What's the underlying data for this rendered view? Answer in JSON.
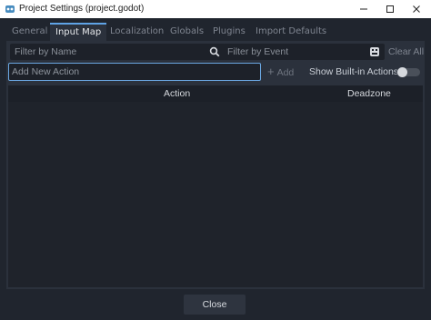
{
  "window": {
    "title": "Project Settings (project.godot)",
    "app_icon": "godot-icon",
    "controls": [
      "minimize-icon",
      "maximize-icon",
      "close-icon"
    ]
  },
  "tabs": [
    {
      "label": "General",
      "active": false
    },
    {
      "label": "Input Map",
      "active": true
    },
    {
      "label": "Localization",
      "active": false
    },
    {
      "label": "Globals",
      "active": false
    },
    {
      "label": "Plugins",
      "active": false
    },
    {
      "label": "Import Defaults",
      "active": false
    }
  ],
  "filters": {
    "name_placeholder": "Filter by Name",
    "name_icon": "search-icon",
    "event_placeholder": "Filter by Event",
    "event_icon": "keyboard-icon",
    "clear_all_label": "Clear All"
  },
  "add_action": {
    "placeholder": "Add New Action",
    "add_label": "Add",
    "show_builtin_label": "Show Built-in Actions",
    "show_builtin_on": false
  },
  "table": {
    "columns": [
      "Action",
      "Deadzone"
    ],
    "rows": []
  },
  "footer": {
    "close_label": "Close"
  },
  "colors": {
    "accent": "#5fa3e6",
    "background": "#20252e",
    "panel": "#2b313c"
  }
}
